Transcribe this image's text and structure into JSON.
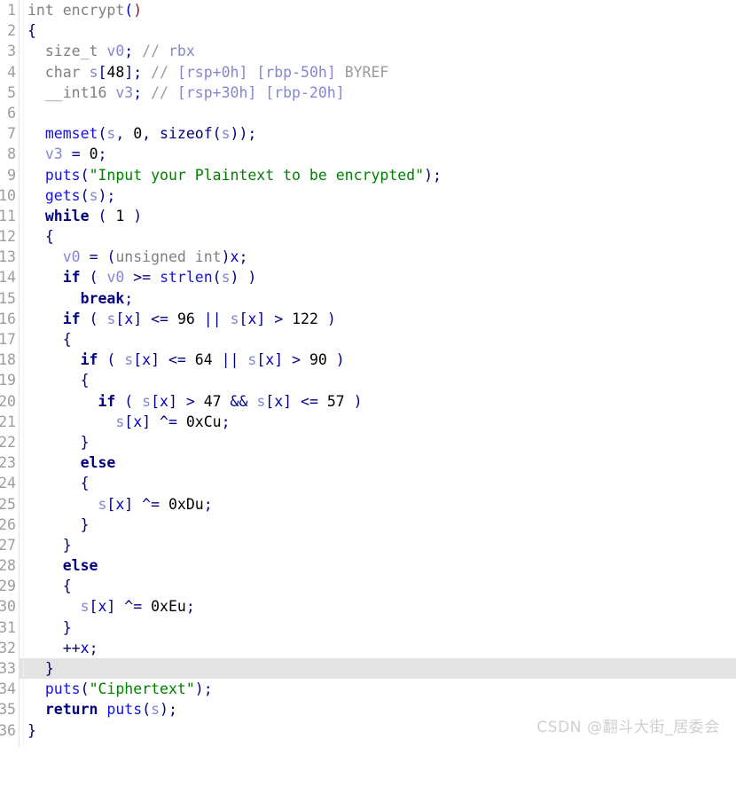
{
  "app": {
    "view_name": "Hex-Rays Pseudocode",
    "language": "C",
    "function_name": "encrypt"
  },
  "colors": {
    "background": "#ffffff",
    "gutter_text": "#9c9c9c",
    "current_line_highlight": "#e3e3e3",
    "type": "#808080",
    "keyword": "#000080",
    "function_call": "#1414e0",
    "variable": "#8585d4",
    "string": "#008000",
    "number": "#000000",
    "comment": "#9a9a9a",
    "comment_stackref": "#8585d4",
    "watermark": "#cfcfcf"
  },
  "watermark": {
    "text": "CSDN @翻斗大街_居委会"
  },
  "editor": {
    "current_line": 33,
    "first_line": 1,
    "last_line": 36,
    "total_lines": 36
  },
  "code": {
    "lines": [
      {
        "n": 1,
        "text": "int encrypt()"
      },
      {
        "n": 2,
        "text": "{"
      },
      {
        "n": 3,
        "text": "  size_t v0; // rbx"
      },
      {
        "n": 4,
        "text": "  char s[48]; // [rsp+0h] [rbp-50h] BYREF"
      },
      {
        "n": 5,
        "text": "  __int16 v3; // [rsp+30h] [rbp-20h]"
      },
      {
        "n": 6,
        "text": ""
      },
      {
        "n": 7,
        "text": "  memset(s, 0, sizeof(s));"
      },
      {
        "n": 8,
        "text": "  v3 = 0;"
      },
      {
        "n": 9,
        "text": "  puts(\"Input your Plaintext to be encrypted\");"
      },
      {
        "n": 10,
        "text": "  gets(s);"
      },
      {
        "n": 11,
        "text": "  while ( 1 )"
      },
      {
        "n": 12,
        "text": "  {"
      },
      {
        "n": 13,
        "text": "    v0 = (unsigned int)x;"
      },
      {
        "n": 14,
        "text": "    if ( v0 >= strlen(s) )"
      },
      {
        "n": 15,
        "text": "      break;"
      },
      {
        "n": 16,
        "text": "    if ( s[x] <= 96 || s[x] > 122 )"
      },
      {
        "n": 17,
        "text": "    {"
      },
      {
        "n": 18,
        "text": "      if ( s[x] <= 64 || s[x] > 90 )"
      },
      {
        "n": 19,
        "text": "      {"
      },
      {
        "n": 20,
        "text": "        if ( s[x] > 47 && s[x] <= 57 )"
      },
      {
        "n": 21,
        "text": "          s[x] ^= 0xCu;"
      },
      {
        "n": 22,
        "text": "      }"
      },
      {
        "n": 23,
        "text": "      else"
      },
      {
        "n": 24,
        "text": "      {"
      },
      {
        "n": 25,
        "text": "        s[x] ^= 0xDu;"
      },
      {
        "n": 26,
        "text": "      }"
      },
      {
        "n": 27,
        "text": "    }"
      },
      {
        "n": 28,
        "text": "    else"
      },
      {
        "n": 29,
        "text": "    {"
      },
      {
        "n": 30,
        "text": "      s[x] ^= 0xEu;"
      },
      {
        "n": 31,
        "text": "    }"
      },
      {
        "n": 32,
        "text": "    ++x;"
      },
      {
        "n": 33,
        "text": "  }"
      },
      {
        "n": 34,
        "text": "  puts(\"Ciphertext\");"
      },
      {
        "n": 35,
        "text": "  return puts(s);"
      },
      {
        "n": 36,
        "text": "}"
      }
    ],
    "line_numbers": [
      "1",
      "2",
      "3",
      "4",
      "5",
      "6",
      "7",
      "8",
      "9",
      "10",
      "11",
      "12",
      "13",
      "14",
      "15",
      "16",
      "17",
      "18",
      "19",
      "20",
      "21",
      "22",
      "23",
      "24",
      "25",
      "26",
      "27",
      "28",
      "29",
      "30",
      "31",
      "32",
      "33",
      "34",
      "35",
      "36"
    ],
    "identifiers": {
      "types": [
        "int",
        "size_t",
        "char",
        "__int16",
        "unsigned int"
      ],
      "variables": [
        "v0",
        "s",
        "v3",
        "x"
      ],
      "calls": [
        "memset",
        "sizeof",
        "puts",
        "gets",
        "strlen"
      ],
      "keywords": [
        "while",
        "if",
        "else",
        "break",
        "return"
      ],
      "strings": [
        "Input your Plaintext to be encrypted",
        "Ciphertext"
      ],
      "numbers": [
        "48",
        "0",
        "1",
        "96",
        "122",
        "64",
        "90",
        "47",
        "57",
        "0xCu",
        "0xDu",
        "0xEu"
      ],
      "comments": [
        "// rbx",
        "// [rsp+0h] [rbp-50h] BYREF",
        "// [rsp+30h] [rbp-20h]"
      ],
      "stack_refs": [
        "rbx",
        "[rsp+0h]",
        "[rbp-50h]",
        "BYREF",
        "[rsp+30h]",
        "[rbp-20h]"
      ]
    }
  }
}
